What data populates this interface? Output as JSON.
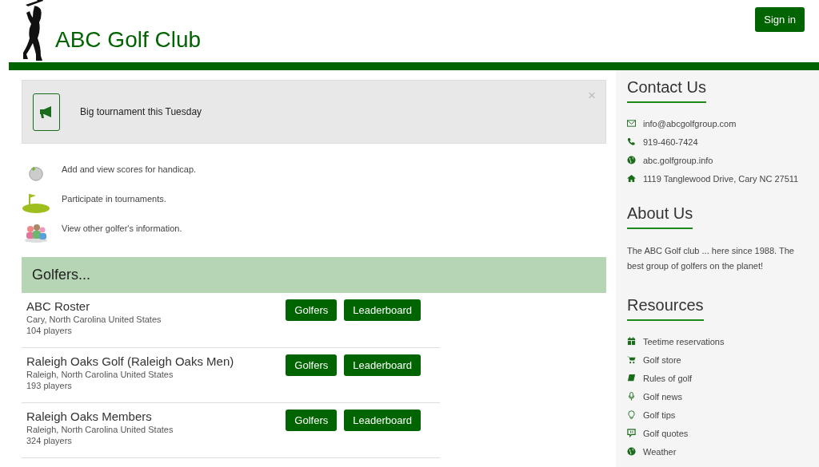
{
  "header": {
    "title": "ABC Golf Club",
    "sign_in": "Sign in"
  },
  "alert": {
    "text": "Big tournament this Tuesday",
    "close": "×"
  },
  "features": [
    {
      "kind": "ball",
      "text": "Add and view scores for handicap."
    },
    {
      "kind": "flag",
      "text": "Participate in tournaments."
    },
    {
      "kind": "people",
      "text": "View other golfer's information."
    }
  ],
  "golfers": {
    "heading": "Golfers...",
    "rows": [
      {
        "name": "ABC Roster",
        "location": "Cary, North Carolina United States",
        "players": "104 players",
        "buttons": [
          "Golfers",
          "Leaderboard"
        ]
      },
      {
        "name": "Raleigh Oaks Golf (Raleigh Oaks Men)",
        "location": "Raleigh, North Carolina United States",
        "players": "193 players",
        "buttons": [
          "Golfers",
          "Leaderboard"
        ]
      },
      {
        "name": "Raleigh Oaks Members",
        "location": "Raleigh, North Carolina United States",
        "players": "324 players",
        "buttons": [
          "Golfers",
          "Leaderboard"
        ]
      }
    ]
  },
  "sidebar": {
    "contact": {
      "heading": "Contact Us",
      "items": [
        {
          "kind": "email",
          "text": "info@abcgolfgroup.com"
        },
        {
          "kind": "phone",
          "text": "919-460-7424"
        },
        {
          "kind": "globe",
          "text": "abc.golfgroup.info"
        },
        {
          "kind": "home",
          "text": "1119 Tanglewood Drive, Cary NC 27511"
        }
      ]
    },
    "about": {
      "heading": "About Us",
      "text": "The ABC Golf club ... here since 1988. The best group of golfers on the planet!"
    },
    "resources": {
      "heading": "Resources",
      "items": [
        {
          "kind": "calendar",
          "text": "Teetime reservations"
        },
        {
          "kind": "cart",
          "text": "Golf store"
        },
        {
          "kind": "book",
          "text": "Rules of golf"
        },
        {
          "kind": "mic",
          "text": "Golf news"
        },
        {
          "kind": "bulb",
          "text": "Golf tips"
        },
        {
          "kind": "chat",
          "text": "Golf quotes"
        },
        {
          "kind": "globe",
          "text": "Weather"
        }
      ]
    }
  }
}
